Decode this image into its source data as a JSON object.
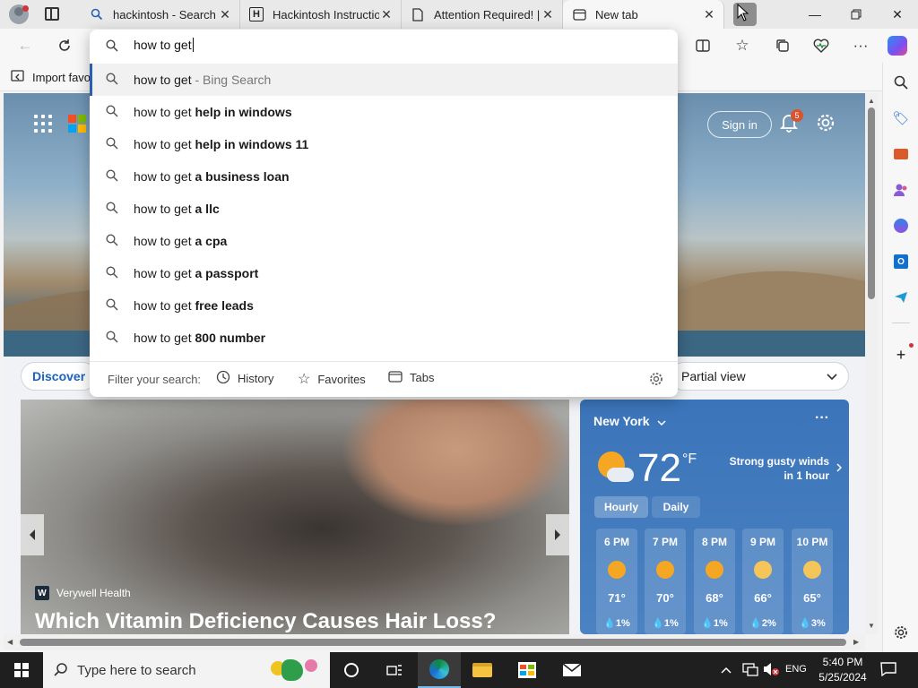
{
  "tabs": [
    {
      "label": "hackintosh - Search",
      "icon": "search-icon"
    },
    {
      "label": "Hackintosh Instructio",
      "icon": "h-logo-icon",
      "icon_text": "H"
    },
    {
      "label": "Attention Required! |",
      "icon": "document-icon"
    },
    {
      "label": "New tab",
      "icon": "newtab-icon",
      "active": true
    }
  ],
  "address": {
    "query": "how to get"
  },
  "favorites_bar": {
    "import_label": "Import favo"
  },
  "suggestions": [
    {
      "prefix": "how to get",
      "bold": "",
      "suffix": " - Bing Search",
      "selected": true
    },
    {
      "prefix": "how to get ",
      "bold": "help in windows",
      "suffix": ""
    },
    {
      "prefix": "how to get ",
      "bold": "help in windows 11",
      "suffix": ""
    },
    {
      "prefix": "how to get ",
      "bold": "a business loan",
      "suffix": ""
    },
    {
      "prefix": "how to get ",
      "bold": "a llc",
      "suffix": ""
    },
    {
      "prefix": "how to get ",
      "bold": "a cpa",
      "suffix": ""
    },
    {
      "prefix": "how to get ",
      "bold": "a passport",
      "suffix": ""
    },
    {
      "prefix": "how to get ",
      "bold": "free leads",
      "suffix": ""
    },
    {
      "prefix": "how to get ",
      "bold": "800 number",
      "suffix": ""
    }
  ],
  "filter": {
    "label": "Filter your search:",
    "history": "History",
    "favorites": "Favorites",
    "tabs": "Tabs"
  },
  "newtab": {
    "signin": "Sign in",
    "notification_count": "5",
    "discover": "Discover",
    "view_mode": "Partial view"
  },
  "news": {
    "source": "Verywell Health",
    "headline": "Which Vitamin Deficiency Causes Hair Loss?"
  },
  "weather": {
    "location": "New York",
    "temp": "72",
    "unit": "°F",
    "alert_line1": "Strong gusty winds",
    "alert_line2": "in 1 hour",
    "tab_hourly": "Hourly",
    "tab_daily": "Daily",
    "hours": [
      {
        "time": "6 PM",
        "temp": "71°",
        "precip": "1%"
      },
      {
        "time": "7 PM",
        "temp": "70°",
        "precip": "1%"
      },
      {
        "time": "8 PM",
        "temp": "68°",
        "precip": "1%"
      },
      {
        "time": "9 PM",
        "temp": "66°",
        "precip": "2%"
      },
      {
        "time": "10 PM",
        "temp": "65°",
        "precip": "3%"
      }
    ]
  },
  "taskbar": {
    "search_placeholder": "Type here to search",
    "lang": "ENG",
    "time": "5:40 PM",
    "date": "5/25/2024"
  },
  "colors": {
    "accent": "#2a5fb0",
    "weather_bg": "#3b74b9",
    "taskbar_bg": "#1f1f1f"
  }
}
